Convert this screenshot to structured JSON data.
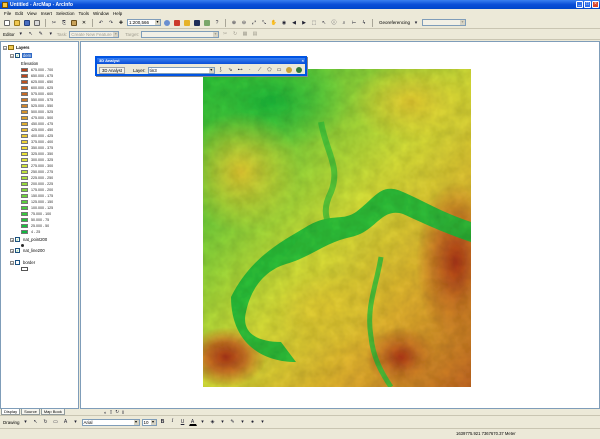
{
  "window": {
    "title": "Untitled - ArcMap - ArcInfo"
  },
  "menu": {
    "items": [
      "File",
      "Edit",
      "View",
      "Insert",
      "Selection",
      "Tools",
      "Window",
      "Help"
    ]
  },
  "toolbar": {
    "scale": "1:200,566",
    "georeferencing_label": "Georeferencing",
    "editor_label": "Editor",
    "task_label": "Task:",
    "task_value": "Create New Feature",
    "target_label": "Target:"
  },
  "toc": {
    "root": "Layers",
    "layers": [
      {
        "name": "dem",
        "checked": true,
        "selected": true
      },
      {
        "name": "nat_point200",
        "checked": true,
        "selected": false
      },
      {
        "name": "nat_line200",
        "checked": true,
        "selected": false
      },
      {
        "name": "border",
        "checked": false,
        "selected": false
      }
    ],
    "legend_title": "Elevation",
    "legend": [
      {
        "label": "675.000 - 700",
        "color": "#b33a1a"
      },
      {
        "label": "650.000 - 675",
        "color": "#b8451c"
      },
      {
        "label": "625.000 - 650",
        "color": "#bd511e"
      },
      {
        "label": "600.000 - 625",
        "color": "#c25d21"
      },
      {
        "label": "575.000 - 600",
        "color": "#c76a24"
      },
      {
        "label": "550.000 - 575",
        "color": "#cc7826"
      },
      {
        "label": "525.000 - 550",
        "color": "#d18529"
      },
      {
        "label": "500.000 - 525",
        "color": "#d6932b"
      },
      {
        "label": "475.000 - 500",
        "color": "#dba12d"
      },
      {
        "label": "450.000 - 475",
        "color": "#e0ae2f"
      },
      {
        "label": "425.000 - 450",
        "color": "#e5bb31"
      },
      {
        "label": "400.000 - 425",
        "color": "#e9c733"
      },
      {
        "label": "375.000 - 400",
        "color": "#edd235"
      },
      {
        "label": "350.000 - 375",
        "color": "#efdc37"
      },
      {
        "label": "325.000 - 350",
        "color": "#ebe238"
      },
      {
        "label": "300.000 - 325",
        "color": "#dfe239"
      },
      {
        "label": "275.000 - 300",
        "color": "#cfe23a"
      },
      {
        "label": "250.000 - 275",
        "color": "#bde13b"
      },
      {
        "label": "225.000 - 250",
        "color": "#aade3c"
      },
      {
        "label": "200.000 - 225",
        "color": "#96da3c"
      },
      {
        "label": "175.000 - 200",
        "color": "#82d63c"
      },
      {
        "label": "150.000 - 175",
        "color": "#6ed33c"
      },
      {
        "label": "125.000 - 150",
        "color": "#5acf3c"
      },
      {
        "label": "100.000 - 125",
        "color": "#47cc3c"
      },
      {
        "label": "75.000 - 100",
        "color": "#35c93c"
      },
      {
        "label": "50.000 - 75",
        "color": "#25c43c"
      },
      {
        "label": "25.000 - 50",
        "color": "#18bf3e"
      },
      {
        "label": "4 - 25",
        "color": "#10b940"
      }
    ]
  },
  "toc_tabs": [
    "Display",
    "Source",
    "Map Book"
  ],
  "analyst": {
    "title": "3D Analyst",
    "analyst_button": "3D Analyst",
    "layer_label": "Layer:",
    "layer_value": "tin3"
  },
  "drawbar": {
    "drawing_label": "Drawing",
    "font_value": "Arial",
    "size_value": "10"
  },
  "status": {
    "coordinates": "1639775.921  7367670.37 Meter"
  },
  "colors": {
    "accent": "#0054e3",
    "selection": "#316ac5"
  }
}
